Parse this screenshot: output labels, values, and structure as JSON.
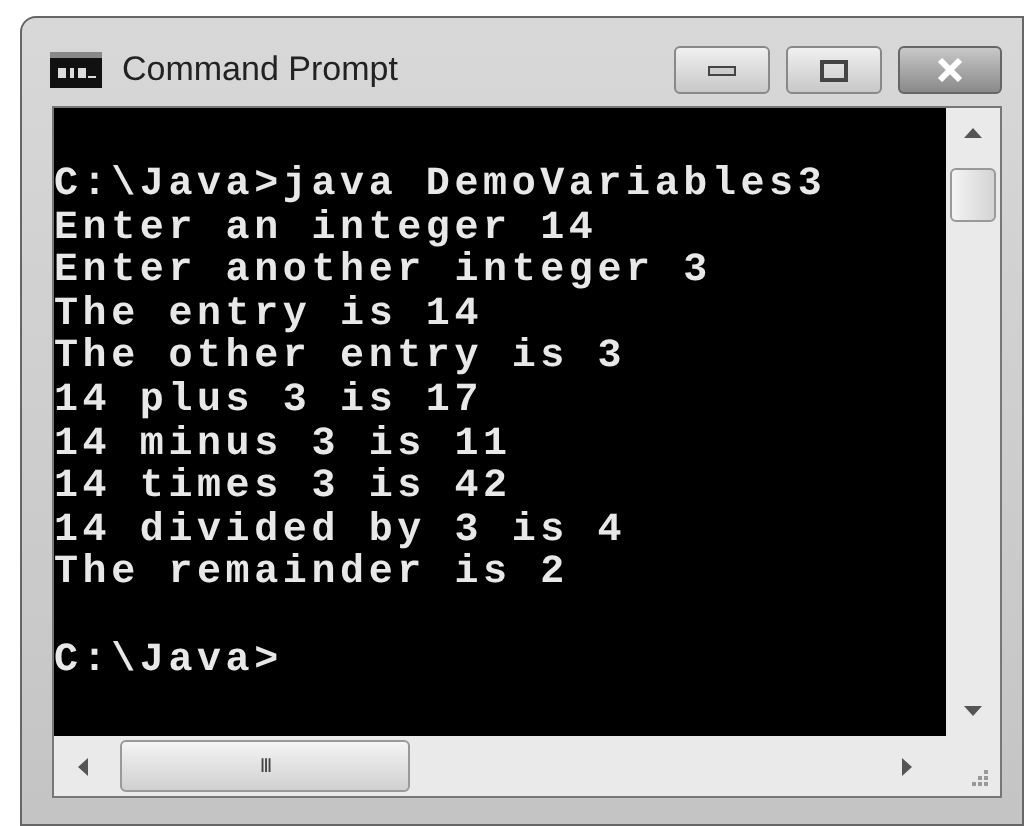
{
  "window": {
    "title": "Command Prompt"
  },
  "console": {
    "lines": [
      "C:\\Java>java DemoVariables3",
      "Enter an integer 14",
      "Enter another integer 3",
      "The entry is 14",
      "The other entry is 3",
      "14 plus 3 is 17",
      "14 minus 3 is 11",
      "14 times 3 is 42",
      "14 divided by 3 is 4",
      "The remainder is 2"
    ],
    "prompt": "C:\\Java>"
  },
  "horizontal_scrollbar": {
    "grip": "III"
  }
}
